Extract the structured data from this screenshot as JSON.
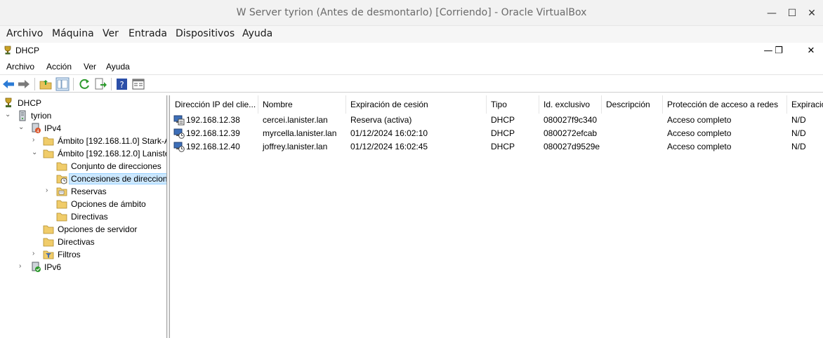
{
  "vbox": {
    "title": "W Server tyrion (Antes de desmontarlo) [Corriendo] - Oracle VirtualBox",
    "controls": {
      "minimize": "—",
      "maximize": "☐",
      "close": "✕"
    },
    "menu": [
      "Archivo",
      "Máquina",
      "Ver",
      "Entrada",
      "Dispositivos",
      "Ayuda"
    ]
  },
  "mmc": {
    "title": "DHCP",
    "controls": {
      "minimize": "—",
      "restore": "❐",
      "close": "✕"
    },
    "menu": [
      "Archivo",
      "Acción",
      "Ver",
      "Ayuda"
    ]
  },
  "tree": [
    {
      "label": "DHCP",
      "icon": "dhcp-root-icon",
      "twisty": ""
    },
    {
      "label": "tyrion",
      "icon": "server-icon",
      "twisty": "⌄"
    },
    {
      "label": "IPv4",
      "icon": "ipv4-icon",
      "twisty": "⌄"
    },
    {
      "label": "Ámbito [192.168.11.0] Stark-A",
      "icon": "folder-icon",
      "twisty": "›"
    },
    {
      "label": "Ámbito [192.168.12.0] Laniste",
      "icon": "folder-icon",
      "twisty": "⌄"
    },
    {
      "label": "Conjunto de direcciones",
      "icon": "folder-icon",
      "twisty": ""
    },
    {
      "label": "Concesiones de direccion",
      "icon": "folder-clock-icon",
      "twisty": ""
    },
    {
      "label": "Reservas",
      "icon": "reservations-icon",
      "twisty": "›"
    },
    {
      "label": "Opciones de ámbito",
      "icon": "folder-icon",
      "twisty": ""
    },
    {
      "label": "Directivas",
      "icon": "folder-icon",
      "twisty": ""
    },
    {
      "label": "Opciones de servidor",
      "icon": "folder-icon",
      "twisty": ""
    },
    {
      "label": "Directivas",
      "icon": "folder-icon",
      "twisty": ""
    },
    {
      "label": "Filtros",
      "icon": "filter-icon",
      "twisty": "›"
    },
    {
      "label": "IPv6",
      "icon": "ipv6-icon",
      "twisty": "›"
    }
  ],
  "list": {
    "columns": [
      "Dirección IP del clie...",
      "Nombre",
      "Expiración de cesión",
      "Tipo",
      "Id. exclusivo",
      "Descripción",
      "Protección de acceso a redes",
      "Expiració"
    ],
    "rows": [
      [
        "192.168.12.38",
        "cercei.lanister.lan",
        "Reserva (activa)",
        "DHCP",
        "080027f9c340",
        "",
        "Acceso completo",
        "N/D"
      ],
      [
        "192.168.12.39",
        "myrcella.lanister.lan",
        "01/12/2024 16:02:10",
        "DHCP",
        "0800272efcab",
        "",
        "Acceso completo",
        "N/D"
      ],
      [
        "192.168.12.40",
        "joffrey.lanister.lan",
        "01/12/2024 16:02:45",
        "DHCP",
        "080027d9529e",
        "",
        "Acceso completo",
        "N/D"
      ]
    ]
  }
}
